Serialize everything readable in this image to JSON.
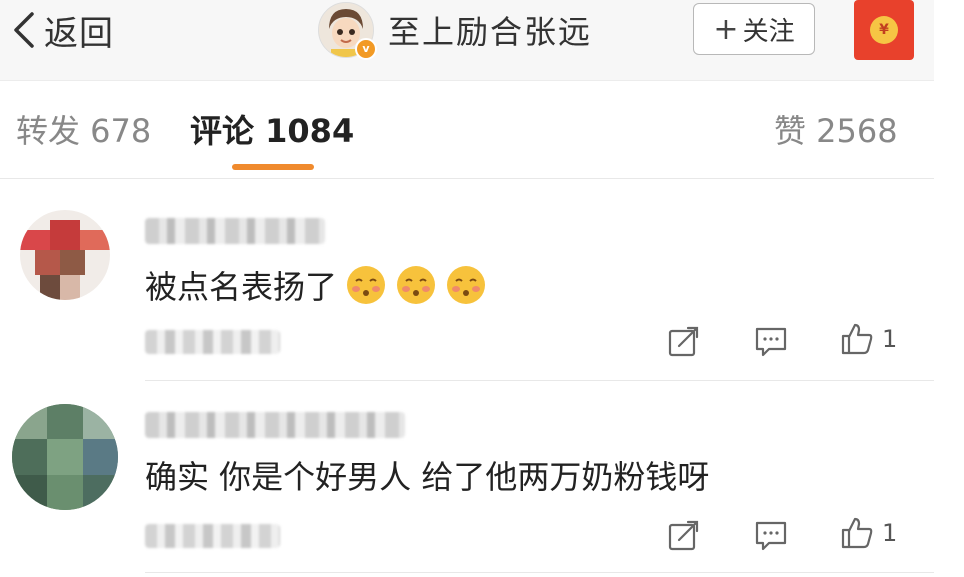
{
  "header": {
    "back_label": "返回",
    "title": "至上励合张远",
    "follow_label": "关注",
    "follow_plus": "+",
    "verified_badge": "v",
    "redpacket_symbol": "¥"
  },
  "tabs": {
    "repost": "转发 678",
    "comment": "评论 1084",
    "like": "赞 2568"
  },
  "comments": [
    {
      "text": "被点名表扬了",
      "emoji_count": 3,
      "likes": "1"
    },
    {
      "text": "确实 你是个好男人 给了他两万奶粉钱呀",
      "emoji_count": 0,
      "likes": "1"
    }
  ],
  "colors": {
    "accent_orange": "#f08a2d",
    "redpacket_red": "#e8412c",
    "verify_badge": "#f29a25"
  },
  "icons": {
    "back": "chevron-left-icon",
    "repost": "share-icon",
    "reply": "comment-icon",
    "like": "thumbs-up-icon",
    "emoji": "blush-kiss-emoji-icon"
  }
}
